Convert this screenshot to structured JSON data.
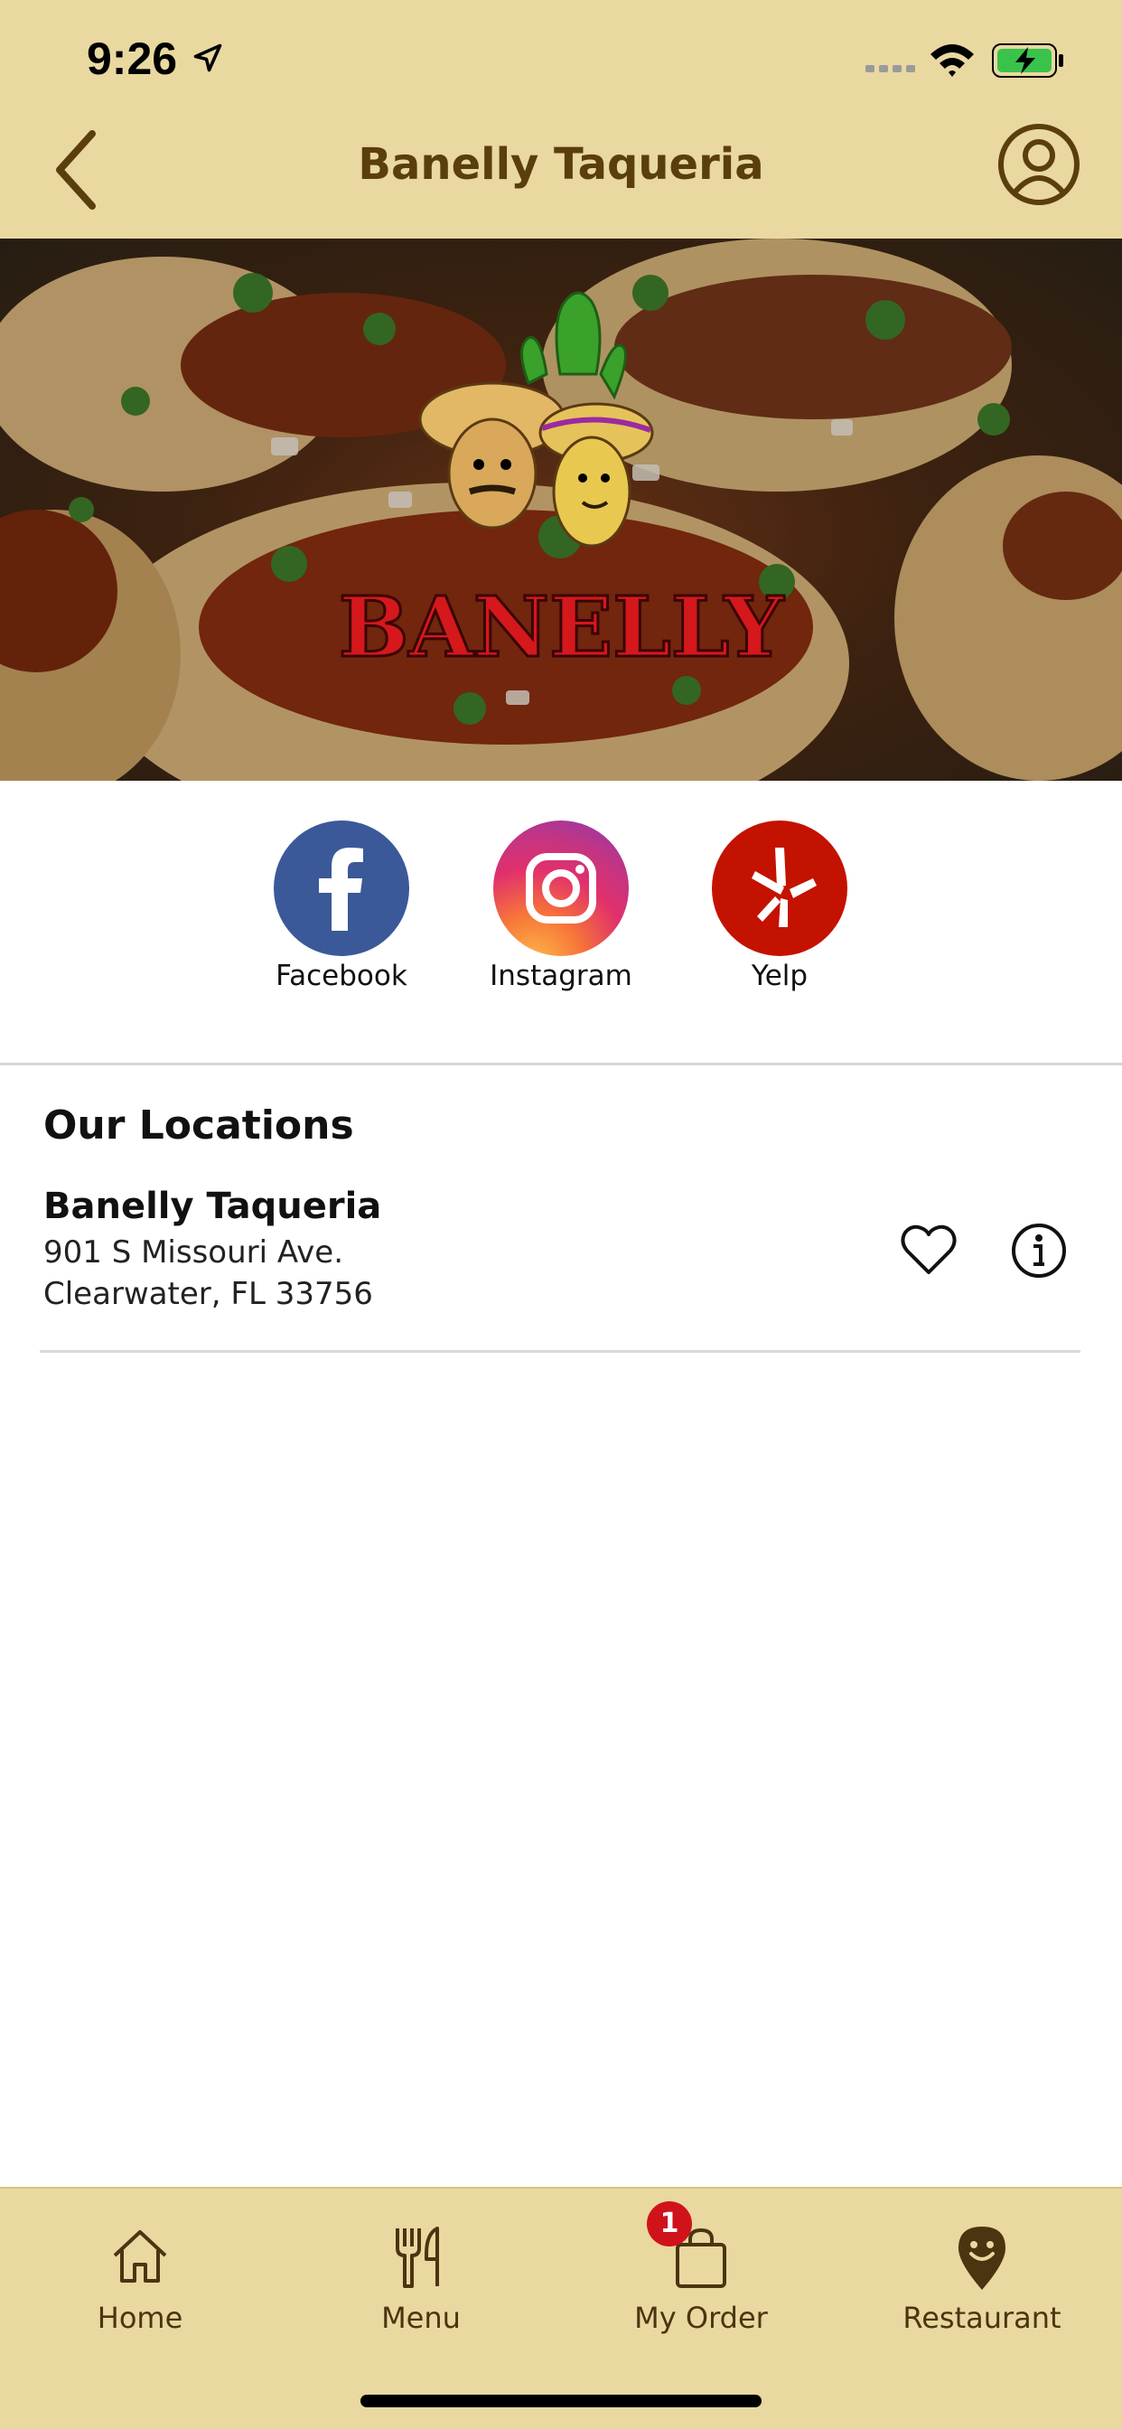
{
  "status_bar": {
    "time": "9:26"
  },
  "header": {
    "title": "Banelly Taqueria"
  },
  "hero": {
    "logo_text": "BANELLY"
  },
  "social": [
    {
      "label": "Facebook",
      "color": "#3b5998"
    },
    {
      "label": "Instagram",
      "color": "#c13584"
    },
    {
      "label": "Yelp",
      "color": "#c41200"
    }
  ],
  "locations": {
    "title": "Our Locations",
    "items": [
      {
        "name": "Banelly Taqueria",
        "address_line1": "901 S Missouri Ave.",
        "address_line2": "Clearwater, FL 33756"
      }
    ]
  },
  "tab_bar": {
    "items": [
      {
        "label": "Home",
        "icon": "house-icon"
      },
      {
        "label": "Menu",
        "icon": "utensils-icon"
      },
      {
        "label": "My Order",
        "icon": "bag-icon",
        "badge": "1"
      },
      {
        "label": "Restaurant",
        "icon": "location-pin-icon"
      }
    ]
  },
  "colors": {
    "bar_bg": "#e9d8a0",
    "title_brown": "#5a3e0c",
    "badge_red": "#d0121b"
  }
}
